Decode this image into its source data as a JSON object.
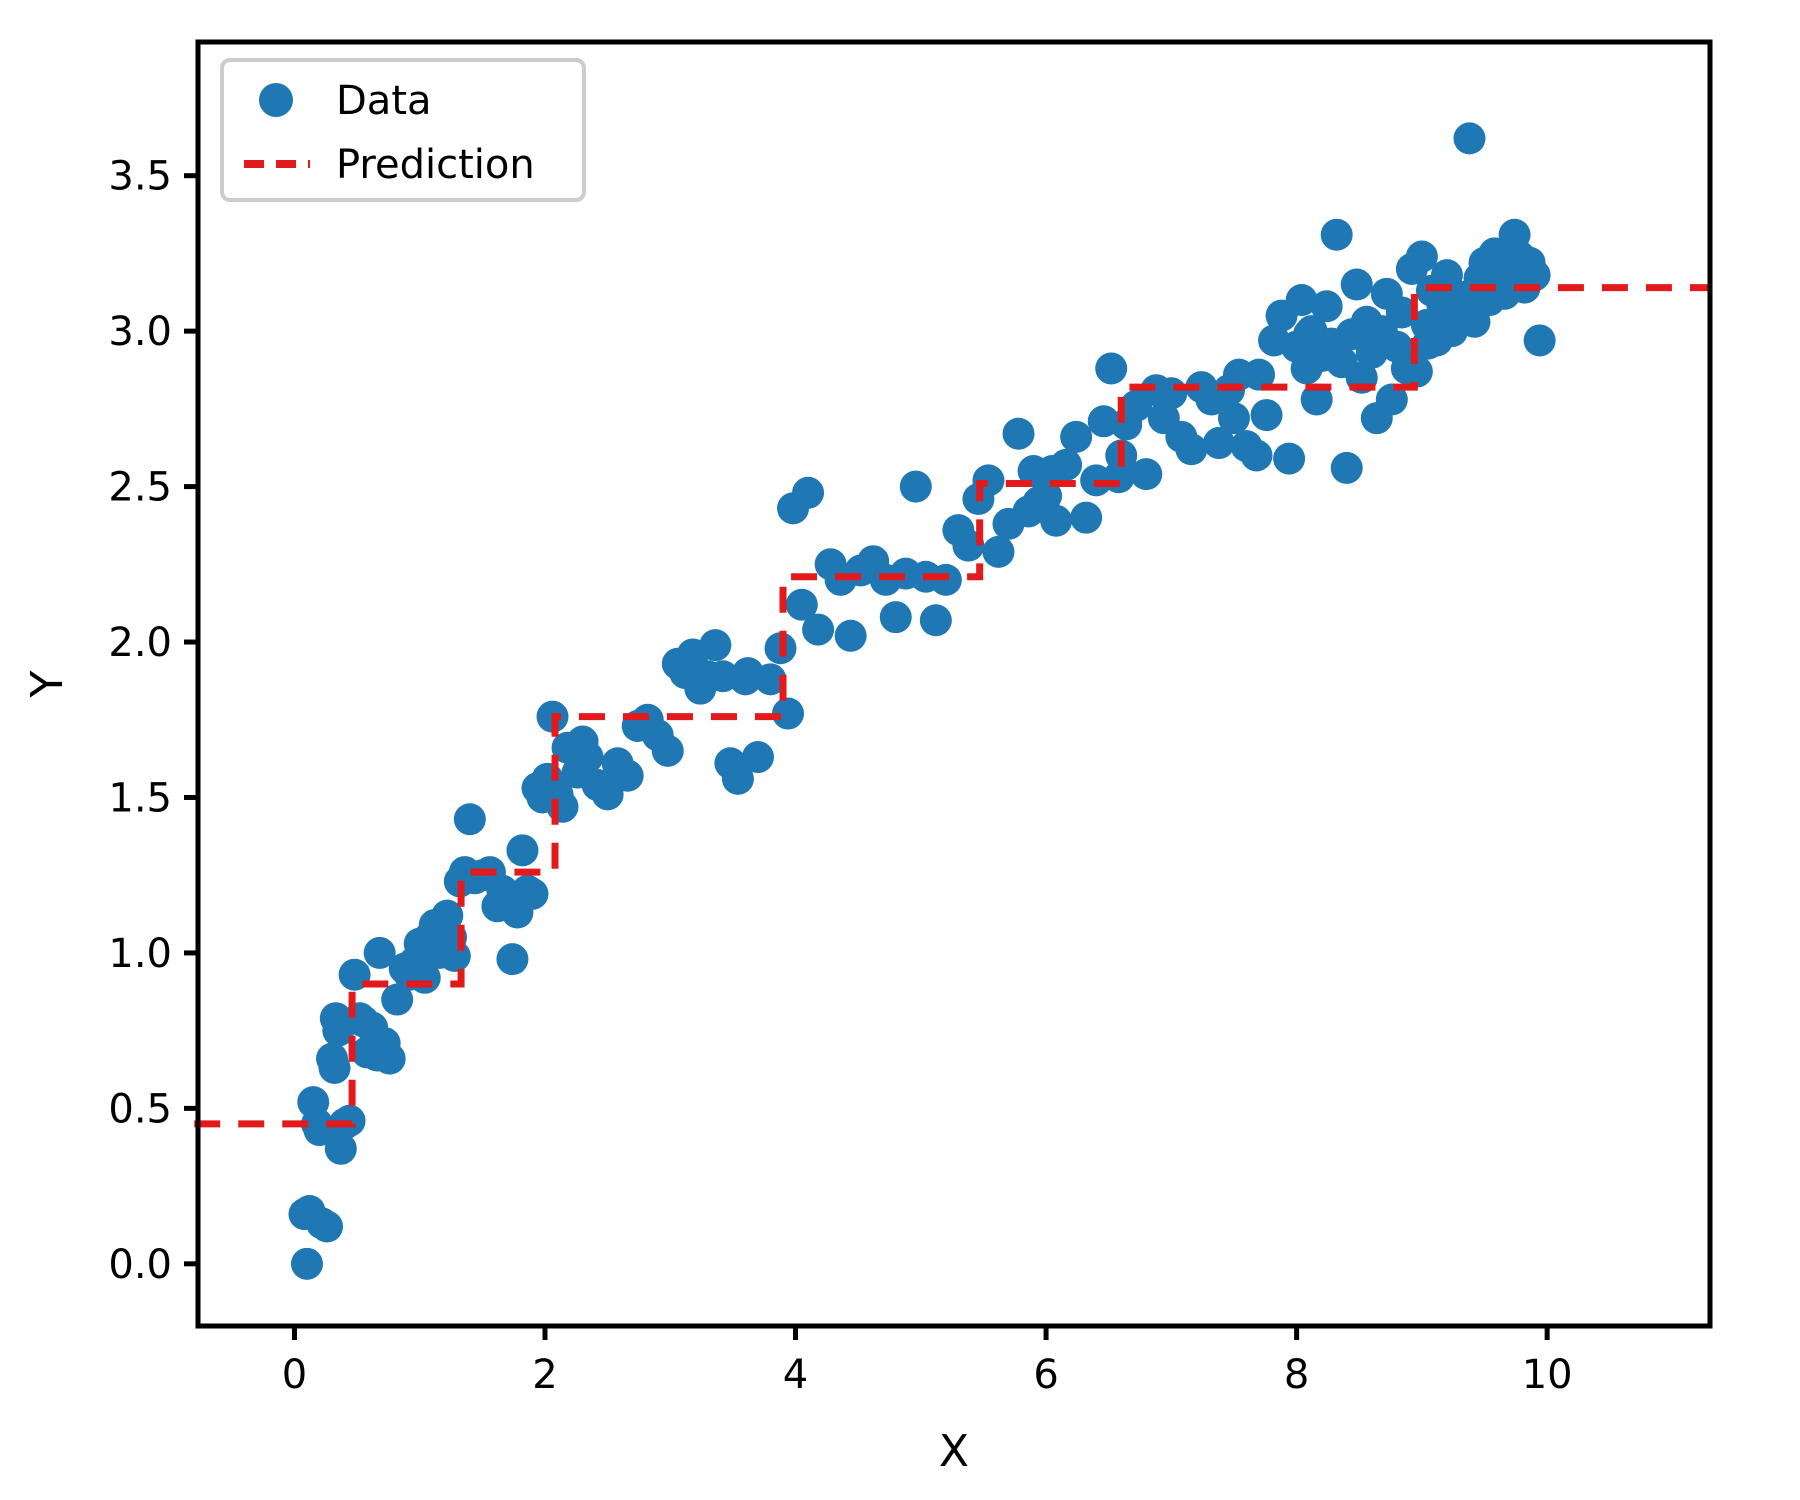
{
  "chart_data": {
    "type": "scatter",
    "title": "",
    "xlabel": "X",
    "ylabel": "Y",
    "xlim": [
      -0.77,
      11.3
    ],
    "ylim": [
      -0.2,
      3.93
    ],
    "xticks": [
      0,
      2,
      4,
      6,
      8,
      10
    ],
    "xtick_labels": [
      "0",
      "2",
      "4",
      "6",
      "8",
      "10"
    ],
    "yticks": [
      0.0,
      0.5,
      1.0,
      1.5,
      2.0,
      2.5,
      3.0,
      3.5
    ],
    "ytick_labels": [
      "0.0",
      "0.5",
      "1.0",
      "1.5",
      "2.0",
      "2.5",
      "3.0",
      "3.5"
    ],
    "grid": false,
    "legend_position": "upper left",
    "series": [
      {
        "name": "Data",
        "type": "scatter",
        "color": "#1f77b4",
        "marker": "o",
        "marker_size": 30,
        "points": [
          [
            0.08,
            0.16
          ],
          [
            0.12,
            0.17
          ],
          [
            0.1,
            0.0
          ],
          [
            0.15,
            0.52
          ],
          [
            0.18,
            0.45
          ],
          [
            0.2,
            0.43
          ],
          [
            0.22,
            0.13
          ],
          [
            0.26,
            0.12
          ],
          [
            0.3,
            0.66
          ],
          [
            0.32,
            0.63
          ],
          [
            0.33,
            0.79
          ],
          [
            0.35,
            0.75
          ],
          [
            0.37,
            0.37
          ],
          [
            0.4,
            0.45
          ],
          [
            0.44,
            0.46
          ],
          [
            0.48,
            0.93
          ],
          [
            0.52,
            0.79
          ],
          [
            0.58,
            0.68
          ],
          [
            0.62,
            0.76
          ],
          [
            0.66,
            0.67
          ],
          [
            0.68,
            1.0
          ],
          [
            0.72,
            0.71
          ],
          [
            0.76,
            0.66
          ],
          [
            0.82,
            0.85
          ],
          [
            0.88,
            0.95
          ],
          [
            0.92,
            0.93
          ],
          [
            0.96,
            0.97
          ],
          [
            1.0,
            1.03
          ],
          [
            1.04,
            0.92
          ],
          [
            1.08,
            1.05
          ],
          [
            1.12,
            1.09
          ],
          [
            1.16,
            1.0
          ],
          [
            1.22,
            1.12
          ],
          [
            1.28,
            0.99
          ],
          [
            1.32,
            1.23
          ],
          [
            1.36,
            1.26
          ],
          [
            1.4,
            1.43
          ],
          [
            1.44,
            1.24
          ],
          [
            1.5,
            1.25
          ],
          [
            1.56,
            1.26
          ],
          [
            1.62,
            1.15
          ],
          [
            1.66,
            1.2
          ],
          [
            1.7,
            1.18
          ],
          [
            1.74,
            0.98
          ],
          [
            1.78,
            1.13
          ],
          [
            1.82,
            1.33
          ],
          [
            1.86,
            1.2
          ],
          [
            1.9,
            1.19
          ],
          [
            1.94,
            1.53
          ],
          [
            1.98,
            1.5
          ],
          [
            2.02,
            1.56
          ],
          [
            2.06,
            1.76
          ],
          [
            2.1,
            1.51
          ],
          [
            2.14,
            1.47
          ],
          [
            2.18,
            1.66
          ],
          [
            2.26,
            1.58
          ],
          [
            2.34,
            1.63
          ],
          [
            2.42,
            1.54
          ],
          [
            2.5,
            1.51
          ],
          [
            2.58,
            1.61
          ],
          [
            2.66,
            1.57
          ],
          [
            2.74,
            1.73
          ],
          [
            2.82,
            1.75
          ],
          [
            2.9,
            1.7
          ],
          [
            2.98,
            1.65
          ],
          [
            3.06,
            1.93
          ],
          [
            3.12,
            1.9
          ],
          [
            3.18,
            1.96
          ],
          [
            3.24,
            1.85
          ],
          [
            3.3,
            1.89
          ],
          [
            3.36,
            1.99
          ],
          [
            3.42,
            1.89
          ],
          [
            3.48,
            1.61
          ],
          [
            3.54,
            1.56
          ],
          [
            3.62,
            1.9
          ],
          [
            3.7,
            1.63
          ],
          [
            3.8,
            1.88
          ],
          [
            3.88,
            1.98
          ],
          [
            3.94,
            1.77
          ],
          [
            3.98,
            2.43
          ],
          [
            4.1,
            2.48
          ],
          [
            4.18,
            2.04
          ],
          [
            4.28,
            2.25
          ],
          [
            4.36,
            2.2
          ],
          [
            4.44,
            2.02
          ],
          [
            4.52,
            2.23
          ],
          [
            4.62,
            2.26
          ],
          [
            4.72,
            2.2
          ],
          [
            4.8,
            2.08
          ],
          [
            4.88,
            2.22
          ],
          [
            4.96,
            2.5
          ],
          [
            5.04,
            2.21
          ],
          [
            5.12,
            2.07
          ],
          [
            5.2,
            2.2
          ],
          [
            5.3,
            2.36
          ],
          [
            5.38,
            2.31
          ],
          [
            5.46,
            2.46
          ],
          [
            5.54,
            2.52
          ],
          [
            5.62,
            2.29
          ],
          [
            5.7,
            2.38
          ],
          [
            5.78,
            2.67
          ],
          [
            5.86,
            2.42
          ],
          [
            5.94,
            2.45
          ],
          [
            6.0,
            2.47
          ],
          [
            6.08,
            2.39
          ],
          [
            6.16,
            2.57
          ],
          [
            6.24,
            2.66
          ],
          [
            6.32,
            2.4
          ],
          [
            6.4,
            2.52
          ],
          [
            6.46,
            2.71
          ],
          [
            6.52,
            2.88
          ],
          [
            6.58,
            2.53
          ],
          [
            6.64,
            2.7
          ],
          [
            6.72,
            2.76
          ],
          [
            6.8,
            2.54
          ],
          [
            6.88,
            2.81
          ],
          [
            6.94,
            2.72
          ],
          [
            7.0,
            2.8
          ],
          [
            7.08,
            2.66
          ],
          [
            7.16,
            2.62
          ],
          [
            7.24,
            2.82
          ],
          [
            7.32,
            2.78
          ],
          [
            7.38,
            2.64
          ],
          [
            7.46,
            2.81
          ],
          [
            7.54,
            2.86
          ],
          [
            7.6,
            2.63
          ],
          [
            7.68,
            2.6
          ],
          [
            7.76,
            2.73
          ],
          [
            7.82,
            2.97
          ],
          [
            7.88,
            3.05
          ],
          [
            7.94,
            2.59
          ],
          [
            8.0,
            2.95
          ],
          [
            8.04,
            3.1
          ],
          [
            8.08,
            2.88
          ],
          [
            8.12,
            3.0
          ],
          [
            8.16,
            2.78
          ],
          [
            8.2,
            2.92
          ],
          [
            8.24,
            3.08
          ],
          [
            8.28,
            2.96
          ],
          [
            8.32,
            3.31
          ],
          [
            8.36,
            2.9
          ],
          [
            8.4,
            2.56
          ],
          [
            8.44,
            2.99
          ],
          [
            8.48,
            3.15
          ],
          [
            8.52,
            2.85
          ],
          [
            8.56,
            3.03
          ],
          [
            8.6,
            2.93
          ],
          [
            8.64,
            2.72
          ],
          [
            8.68,
            3.0
          ],
          [
            8.72,
            3.12
          ],
          [
            8.76,
            2.78
          ],
          [
            8.8,
            2.95
          ],
          [
            8.84,
            3.06
          ],
          [
            8.88,
            2.88
          ],
          [
            8.92,
            3.2
          ],
          [
            8.96,
            2.87
          ],
          [
            9.0,
            3.24
          ],
          [
            9.04,
            3.02
          ],
          [
            9.08,
            3.13
          ],
          [
            9.12,
            2.97
          ],
          [
            9.16,
            3.09
          ],
          [
            9.2,
            3.18
          ],
          [
            9.24,
            3.0
          ],
          [
            9.28,
            3.05
          ],
          [
            9.34,
            3.11
          ],
          [
            9.38,
            3.62
          ],
          [
            9.42,
            3.03
          ],
          [
            9.46,
            3.17
          ],
          [
            9.5,
            3.22
          ],
          [
            9.54,
            3.1
          ],
          [
            9.58,
            3.25
          ],
          [
            9.62,
            3.19
          ],
          [
            9.66,
            3.12
          ],
          [
            9.7,
            3.2
          ],
          [
            9.74,
            3.31
          ],
          [
            9.78,
            3.24
          ],
          [
            9.82,
            3.14
          ],
          [
            9.86,
            3.22
          ],
          [
            9.9,
            3.18
          ],
          [
            9.94,
            2.97
          ],
          [
            6.6,
            2.6
          ],
          [
            7.7,
            2.86
          ],
          [
            8.1,
            2.99
          ],
          [
            5.9,
            2.55
          ],
          [
            3.6,
            1.88
          ],
          [
            2.3,
            1.68
          ],
          [
            1.25,
            1.05
          ],
          [
            0.55,
            0.78
          ],
          [
            4.05,
            2.12
          ],
          [
            6.05,
            2.55
          ],
          [
            7.5,
            2.72
          ],
          [
            9.05,
            2.96
          ]
        ]
      },
      {
        "name": "Prediction",
        "type": "step",
        "color": "#e31a1c",
        "linestyle": "dashed",
        "linewidth": 7,
        "steps": [
          {
            "x0": -0.8,
            "x1": 0.46,
            "y": 0.45
          },
          {
            "x0": 0.46,
            "x1": 1.33,
            "y": 0.9
          },
          {
            "x0": 1.33,
            "x1": 2.08,
            "y": 1.26
          },
          {
            "x0": 2.08,
            "x1": 3.9,
            "y": 1.76
          },
          {
            "x0": 3.9,
            "x1": 5.47,
            "y": 2.21
          },
          {
            "x0": 5.47,
            "x1": 6.6,
            "y": 2.51
          },
          {
            "x0": 6.6,
            "x1": 8.94,
            "y": 2.82
          },
          {
            "x0": 8.94,
            "x1": 11.3,
            "y": 3.14
          }
        ]
      }
    ],
    "legend": [
      {
        "label": "Data",
        "marker": "circle",
        "color": "#1f77b4"
      },
      {
        "label": "Prediction",
        "marker": "dashed-line",
        "color": "#e31a1c"
      }
    ]
  }
}
